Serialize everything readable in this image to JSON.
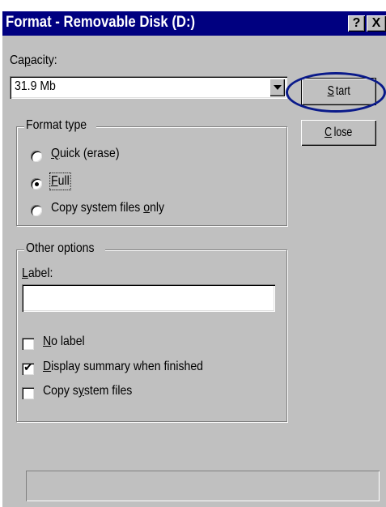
{
  "window": {
    "title": "Format - Removable Disk (D:)",
    "help_glyph": "?",
    "close_glyph": "X"
  },
  "capacity": {
    "label_before": "Ca",
    "label_mnemonic": "p",
    "label_after": "acity:",
    "value": "31.9 Mb"
  },
  "buttons": {
    "start_mnemonic": "S",
    "start_rest": "tart",
    "close_mnemonic": "C",
    "close_rest": "lose"
  },
  "format_type": {
    "title": "Format type",
    "quick_mnemonic": "Q",
    "quick_rest": "uick (erase)",
    "full_mnemonic": "F",
    "full_rest": "ull",
    "copy_before": "Copy system files ",
    "copy_mnemonic": "o",
    "copy_after": "nly",
    "selected": "Full"
  },
  "other_options": {
    "title": "Other options",
    "label_mnemonic": "L",
    "label_rest": "abel:",
    "label_value": "",
    "nolabel_mnemonic": "N",
    "nolabel_rest": "o label",
    "summary_mnemonic": "D",
    "summary_rest": "isplay summary when finished",
    "summary_checked": true,
    "copyfiles_before": "Copy s",
    "copyfiles_mnemonic": "y",
    "copyfiles_after": "stem files"
  },
  "colors": {
    "titlebar": "#000080",
    "dialog_face": "#c0c0c0",
    "highlight_circle": "#0a1a8a"
  }
}
